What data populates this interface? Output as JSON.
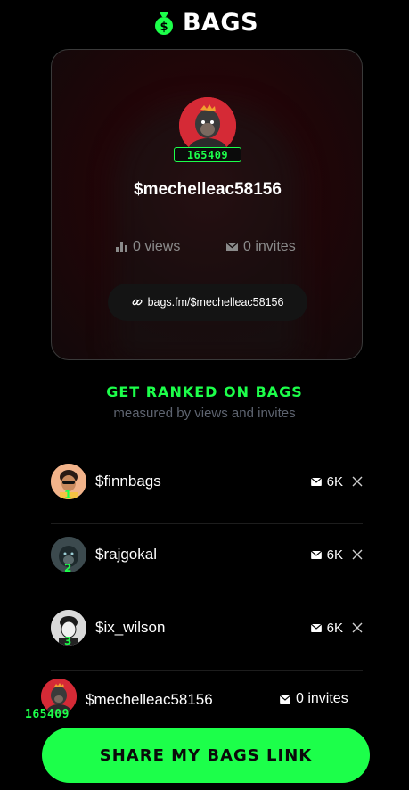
{
  "app": {
    "name": "BAGS"
  },
  "profile": {
    "rank": "165409",
    "username": "$mechelleac58156",
    "views": "0 views",
    "invites": "0 invites",
    "link": "bags.fm/$mechelleac58156"
  },
  "ranking": {
    "title": "GET RANKED ON BAGS",
    "subtitle": "measured by views and invites",
    "leaders": [
      {
        "rank": "1",
        "name": "$finnbags",
        "invites": "6K"
      },
      {
        "rank": "2",
        "name": "$rajgokal",
        "invites": "6K"
      },
      {
        "rank": "3",
        "name": "$ix_wilson",
        "invites": "6K"
      }
    ],
    "self": {
      "rank": "165409",
      "name": "$mechelleac58156",
      "invites": "0 invites"
    }
  },
  "cta": {
    "label": "SHARE MY BAGS LINK"
  },
  "colors": {
    "accent": "#1cff4a",
    "background": "#000000",
    "avatar_red": "#d52a36"
  }
}
